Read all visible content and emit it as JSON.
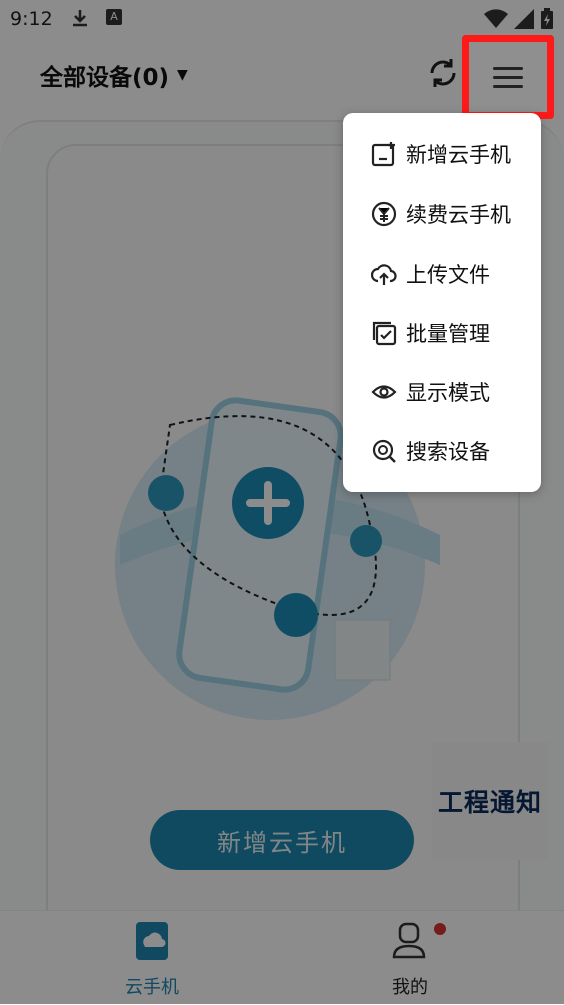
{
  "status_bar": {
    "time": "9:12",
    "a_badge": "A"
  },
  "header": {
    "device_title": "全部设备(0)"
  },
  "main": {
    "add_button_label": "新增云手机"
  },
  "floating_notice": {
    "label": "工程通知"
  },
  "tabs": [
    {
      "label": "云手机",
      "active": true
    },
    {
      "label": "我的",
      "active": false,
      "has_badge": true
    }
  ],
  "dropdown_menu": {
    "items": [
      {
        "label": "新增云手机",
        "icon": "add-phone-icon"
      },
      {
        "label": "续费云手机",
        "icon": "renew-yen-icon"
      },
      {
        "label": "上传文件",
        "icon": "upload-cloud-icon"
      },
      {
        "label": "批量管理",
        "icon": "batch-check-icon"
      },
      {
        "label": "显示模式",
        "icon": "eye-icon"
      },
      {
        "label": "搜索设备",
        "icon": "search-device-icon"
      }
    ]
  },
  "colors": {
    "accent": "#1e88b0",
    "highlight_border": "#ff1a1a",
    "badge": "#d93232"
  }
}
